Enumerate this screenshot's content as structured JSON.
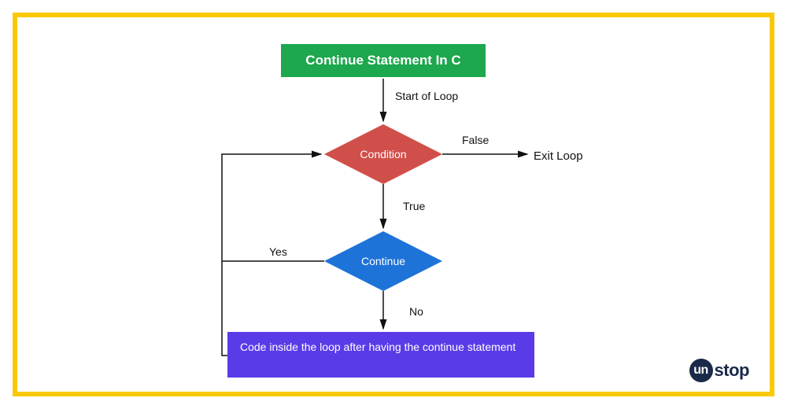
{
  "title": "Continue Statement In C",
  "labels": {
    "start": "Start of Loop",
    "false": "False",
    "exit": "Exit Loop",
    "true": "True",
    "yes": "Yes",
    "no": "No"
  },
  "nodes": {
    "condition": "Condition",
    "continue": "Continue",
    "code": "Code inside the loop after having the continue statement"
  },
  "logo": {
    "badge": "un",
    "text": "stop"
  },
  "chart_data": {
    "type": "flowchart",
    "title": "Continue Statement In C",
    "nodes": [
      {
        "id": "start",
        "label": "Start of Loop",
        "shape": "label"
      },
      {
        "id": "condition",
        "label": "Condition",
        "shape": "diamond",
        "color": "#D14F4A"
      },
      {
        "id": "exit",
        "label": "Exit Loop",
        "shape": "label"
      },
      {
        "id": "continue",
        "label": "Continue",
        "shape": "diamond",
        "color": "#1E73D8"
      },
      {
        "id": "code",
        "label": "Code inside the loop after having the continue statement",
        "shape": "rect",
        "color": "#5B3BE8"
      }
    ],
    "edges": [
      {
        "from": "start",
        "to": "condition",
        "label": ""
      },
      {
        "from": "condition",
        "to": "exit",
        "label": "False"
      },
      {
        "from": "condition",
        "to": "continue",
        "label": "True"
      },
      {
        "from": "continue",
        "to": "condition",
        "label": "Yes",
        "note": "loop back"
      },
      {
        "from": "continue",
        "to": "code",
        "label": "No"
      },
      {
        "from": "code",
        "to": "condition",
        "label": "",
        "note": "loop back"
      }
    ]
  }
}
